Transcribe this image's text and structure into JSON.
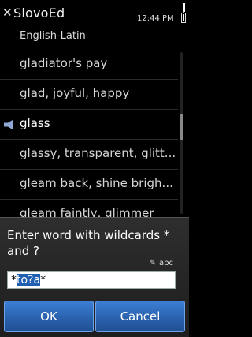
{
  "status_bar": {
    "time": "12:44 PM"
  },
  "header": {
    "close_glyph": "✕",
    "title": "SlovoEd",
    "subtitle": "English-Latin"
  },
  "list": {
    "items": [
      {
        "label": "gladiator's pay"
      },
      {
        "label": "glad, joyful, happy"
      },
      {
        "label": "glass",
        "icon": "speaker-icon",
        "selected": true
      },
      {
        "label": "glassy, transparent, glitt..."
      },
      {
        "label": "gleam back, shine brigh..."
      },
      {
        "label": "gleam faintly, glimmer"
      }
    ]
  },
  "dialog": {
    "prompt": "Enter word with wildcards * and ?",
    "input_mode": "abc",
    "input_value": {
      "before": "*",
      "selected": "to?a",
      "after": "*"
    },
    "ok_label": "OK",
    "cancel_label": "Cancel"
  },
  "colors": {
    "accent": "#2a62ad",
    "selection": "#1f5fb3",
    "background": "#000000"
  }
}
